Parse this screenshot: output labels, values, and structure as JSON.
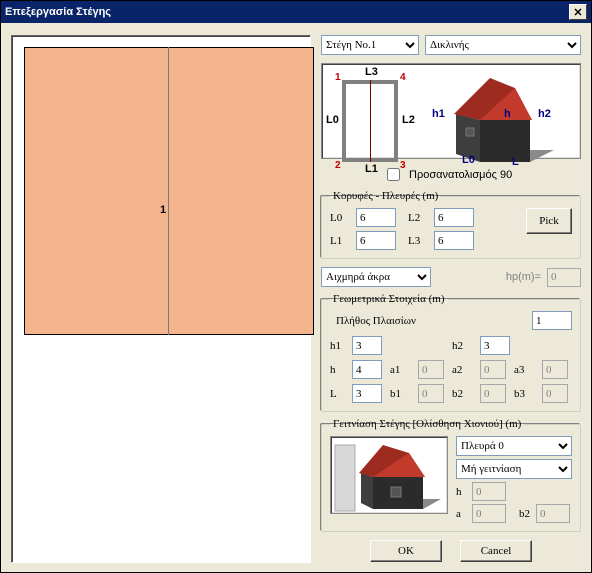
{
  "title": "Επεξεργασία Στέγης",
  "close_glyph": "✕",
  "roof_selector": {
    "selected": "Στέγη No.1"
  },
  "roof_type": {
    "selected": "Δικλινής"
  },
  "diagram": {
    "L0": "L0",
    "L1": "L1",
    "L2": "L2",
    "L3": "L3",
    "c1": "1",
    "c2": "2",
    "c3": "3",
    "c4": "4",
    "h1": "h1",
    "h2": "h2",
    "h": "h",
    "ll0": "L0",
    "ll": "L"
  },
  "orient90_label": "Προσανατολισμός 90",
  "sides_group": {
    "legend": "Κορυφές - Πλευρές (m)",
    "L0_label": "L0",
    "L0_val": "6",
    "L1_label": "L1",
    "L1_val": "6",
    "L2_label": "L2",
    "L2_val": "6",
    "L3_label": "L3",
    "L3_val": "6",
    "pick_label": "Pick"
  },
  "edges": {
    "selected": "Αιχμηρά άκρα",
    "hp_label": "hp(m)=",
    "hp_val": "0"
  },
  "geom": {
    "legend": "Γεωμετρικά Στοιχεία (m)",
    "frames_label": "Πλήθος Πλαισίων",
    "frames_val": "1",
    "h1_label": "h1",
    "h1_val": "3",
    "h2_label": "h2",
    "h2_val": "3",
    "h_label": "h",
    "h_val": "4",
    "L_label": "L",
    "L_val": "3",
    "a1_label": "a1",
    "a1_val": "0",
    "a2_label": "a2",
    "a2_val": "0",
    "a3_label": "a3",
    "a3_val": "0",
    "b1_label": "b1",
    "b1_val": "0",
    "b2_label": "b2",
    "b2_val": "0",
    "b3_label": "b3",
    "b3_val": "0"
  },
  "neighbor": {
    "legend": "Γειτνίαση Στέγης [Ολίσθηση Χιονιού] (m)",
    "side_selected": "Πλευρά 0",
    "mode_selected": "Μή γειτνίαση",
    "h_label": "h",
    "h_val": "0",
    "a_label": "a",
    "a_val": "0",
    "b2_label": "b2",
    "b2_val": "0"
  },
  "buttons": {
    "ok": "OK",
    "cancel": "Cancel"
  },
  "preview_number": "1"
}
